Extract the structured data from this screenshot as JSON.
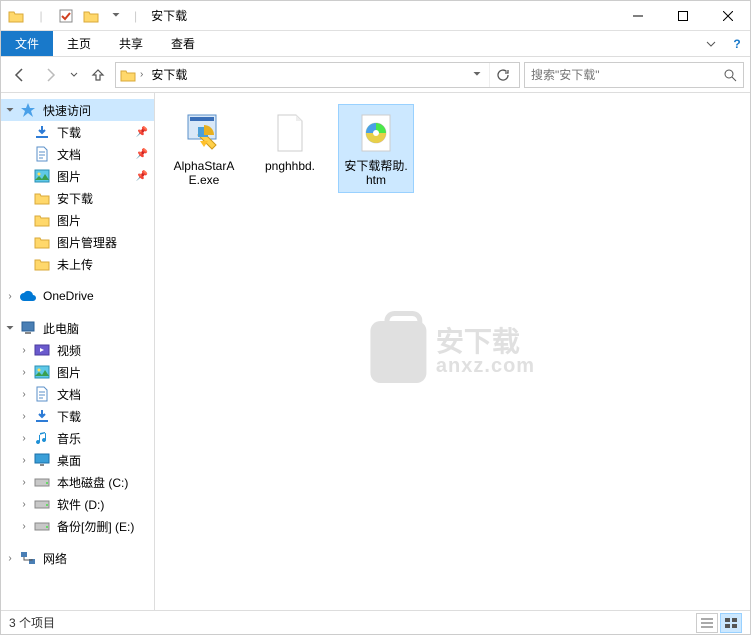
{
  "window": {
    "title": "安下载",
    "min": "—",
    "max": "□",
    "close": "✕"
  },
  "ribbon": {
    "file": "文件",
    "home": "主页",
    "share": "共享",
    "view": "查看"
  },
  "breadcrumb": {
    "current": "安下载"
  },
  "search": {
    "placeholder": "搜索\"安下载\""
  },
  "sidebar": {
    "quick_access": "快速访问",
    "items_quick": [
      {
        "label": "下载",
        "icon": "download",
        "pinned": true
      },
      {
        "label": "文档",
        "icon": "document",
        "pinned": true
      },
      {
        "label": "图片",
        "icon": "picture",
        "pinned": true
      },
      {
        "label": "安下载",
        "icon": "folder",
        "pinned": false
      },
      {
        "label": "图片",
        "icon": "folder",
        "pinned": false
      },
      {
        "label": "图片管理器",
        "icon": "folder",
        "pinned": false
      },
      {
        "label": "未上传",
        "icon": "folder",
        "pinned": false
      }
    ],
    "onedrive": "OneDrive",
    "this_pc": "此电脑",
    "items_pc": [
      {
        "label": "视频",
        "icon": "video"
      },
      {
        "label": "图片",
        "icon": "picture"
      },
      {
        "label": "文档",
        "icon": "document"
      },
      {
        "label": "下载",
        "icon": "download"
      },
      {
        "label": "音乐",
        "icon": "music"
      },
      {
        "label": "桌面",
        "icon": "desktop"
      },
      {
        "label": "本地磁盘 (C:)",
        "icon": "drive"
      },
      {
        "label": "软件 (D:)",
        "icon": "drive"
      },
      {
        "label": "备份[勿删] (E:)",
        "icon": "drive"
      }
    ],
    "network": "网络"
  },
  "files": [
    {
      "name": "AlphaStarAE.exe",
      "icon": "exe",
      "selected": false
    },
    {
      "name": "pnghhbd.",
      "icon": "blank",
      "selected": false
    },
    {
      "name": "安下载帮助.htm",
      "icon": "htm",
      "selected": true
    }
  ],
  "watermark": {
    "top": "安下载",
    "bottom": "anxz.com"
  },
  "status": {
    "count": "3 个项目"
  }
}
